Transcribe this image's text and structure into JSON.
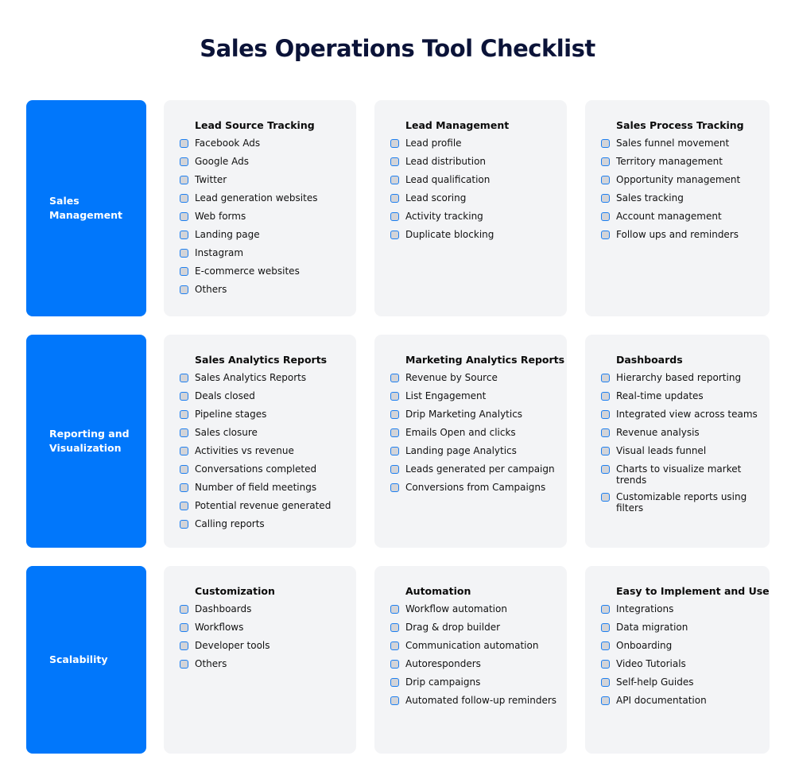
{
  "title": "Sales Operations Tool Checklist",
  "colors": {
    "category_bg": "#0177fb",
    "card_bg": "#f3f4f6",
    "title_text": "#0b1338",
    "checkbox_border": "#1d7ff0",
    "checkbox_fill": "#d3d4d8"
  },
  "rows": [
    {
      "category": "Sales Management",
      "cards": [
        {
          "title": "Lead Source Tracking",
          "items": [
            "Facebook Ads",
            "Google Ads",
            "Twitter",
            "Lead generation websites",
            "Web forms",
            "Landing page",
            "Instagram",
            "E-commerce websites",
            "Others"
          ]
        },
        {
          "title": "Lead Management",
          "items": [
            "Lead profile",
            "Lead distribution",
            "Lead qualification",
            "Lead scoring",
            "Activity tracking",
            "Duplicate blocking"
          ]
        },
        {
          "title": "Sales Process Tracking",
          "items": [
            "Sales funnel movement",
            "Territory management",
            "Opportunity management",
            "Sales tracking",
            "Account management",
            "Follow ups and reminders"
          ]
        }
      ]
    },
    {
      "category": "Reporting and Visualization",
      "cards": [
        {
          "title": "Sales Analytics Reports",
          "items": [
            "Sales Analytics Reports",
            "Deals closed",
            "Pipeline stages",
            "Sales closure",
            "Activities vs revenue",
            "Conversations completed",
            "Number of field meetings",
            "Potential revenue generated",
            "Calling reports"
          ]
        },
        {
          "title": "Marketing Analytics Reports",
          "items": [
            "Revenue by Source",
            "List Engagement",
            "Drip Marketing Analytics",
            "Emails Open and clicks",
            "Landing page Analytics",
            "Leads generated per campaign",
            "Conversions from Campaigns"
          ]
        },
        {
          "title": "Dashboards",
          "items": [
            "Hierarchy based reporting",
            "Real-time updates",
            "Integrated view across teams",
            "Revenue analysis",
            "Visual leads funnel",
            "Charts to visualize market trends",
            "Customizable reports using filters"
          ]
        }
      ]
    },
    {
      "category": "Scalability",
      "cards": [
        {
          "title": "Customization",
          "items": [
            "Dashboards",
            "Workflows",
            "Developer tools",
            "Others"
          ]
        },
        {
          "title": "Automation",
          "items": [
            "Workflow automation",
            "Drag & drop builder",
            "Communication automation",
            "Autoresponders",
            "Drip campaigns",
            "Automated follow-up reminders"
          ]
        },
        {
          "title": "Easy to Implement and Use",
          "items": [
            "Integrations",
            "Data migration",
            "Onboarding",
            "Video Tutorials",
            "Self-help Guides",
            "API documentation"
          ]
        }
      ]
    }
  ]
}
